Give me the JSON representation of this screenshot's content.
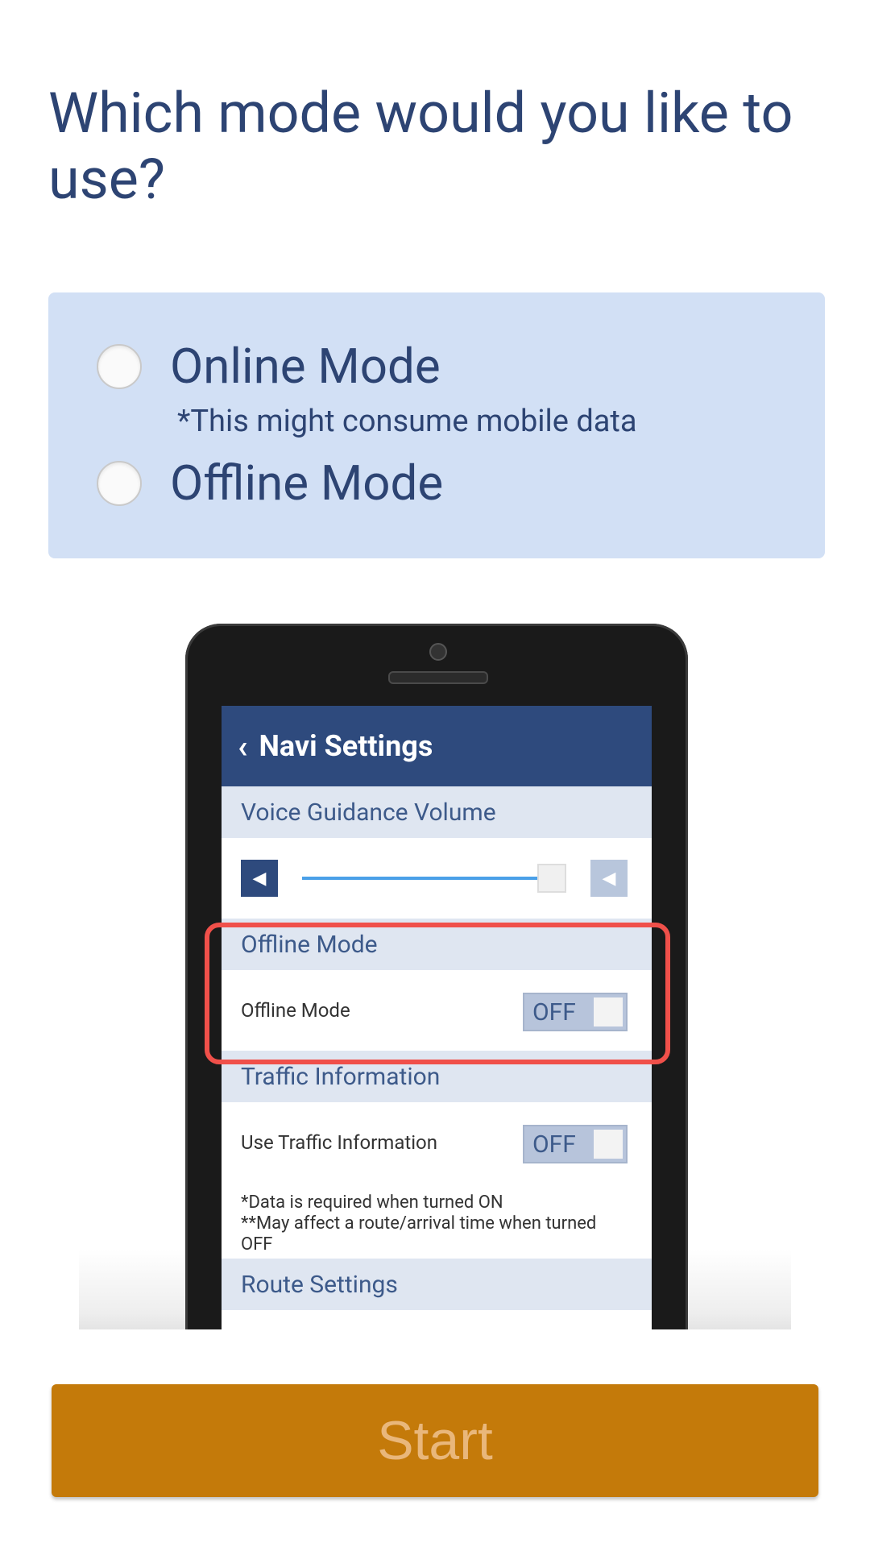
{
  "question": "Which mode would you like to use?",
  "options": [
    {
      "label": "Online Mode",
      "note": "*This might consume mobile data"
    },
    {
      "label": "Offline Mode"
    }
  ],
  "illustration": {
    "header_title": "Navi Settings",
    "voice_section": "Voice Guidance Volume",
    "offline_section": "Offline Mode",
    "offline_row": "Offline Mode",
    "offline_toggle": "OFF",
    "traffic_section": "Traffic Information",
    "traffic_row": "Use Traffic Information",
    "traffic_toggle": "OFF",
    "note_1": "*Data is required when turned ON",
    "note_2": "**May affect a route/arrival time when turned OFF",
    "route_section": "Route Settings"
  },
  "start_button": "Start",
  "colors": {
    "text": "#2d4473",
    "options_bg": "#d2e0f5",
    "button_bg": "#c47a0a",
    "button_text": "#e9b77b",
    "highlight": "#f0504a"
  }
}
